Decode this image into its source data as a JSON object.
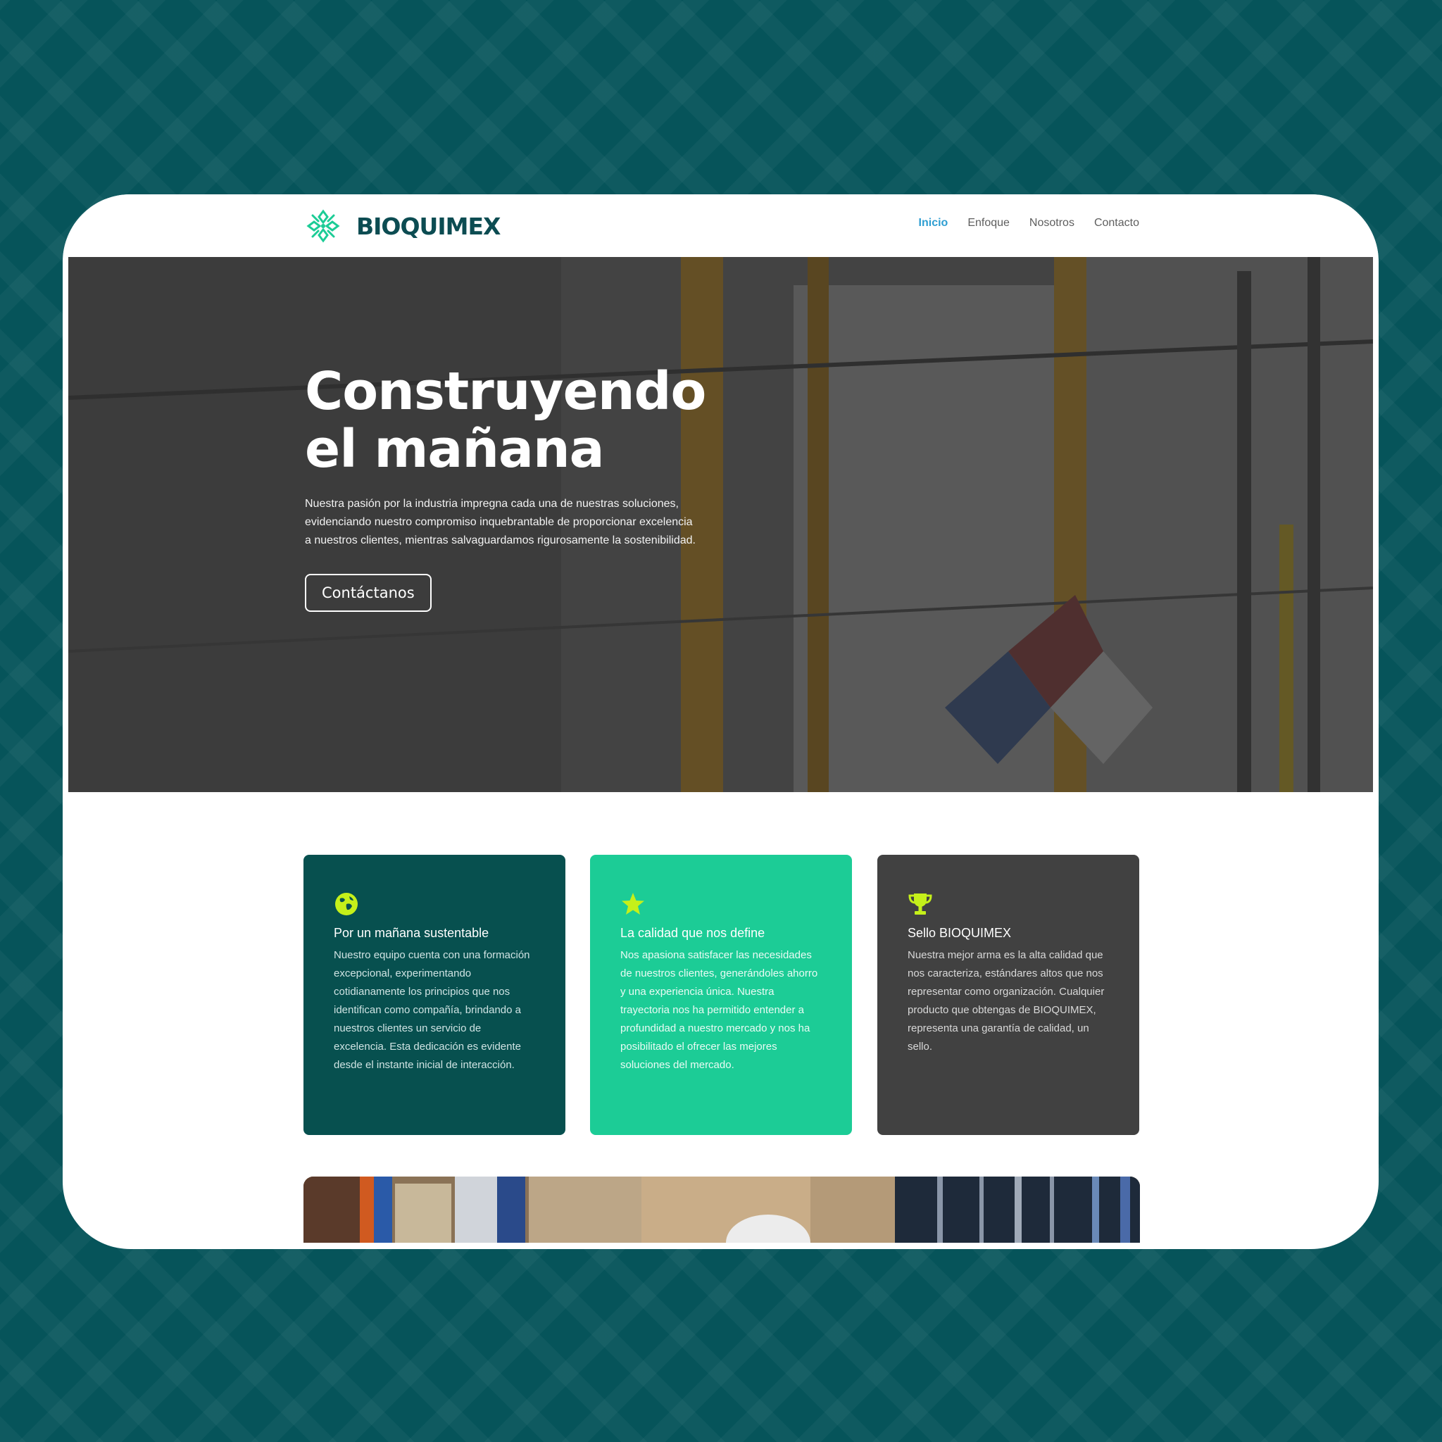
{
  "brand": {
    "name": "BIOQUIMEX",
    "logo_icon": "bioquimex-logo-icon",
    "primary_color": "#0c4c52",
    "accent_color": "#1ccc96",
    "nav_active_color": "#2e9ed2"
  },
  "nav": {
    "items": [
      {
        "label": "Inicio",
        "active": true
      },
      {
        "label": "Enfoque",
        "active": false
      },
      {
        "label": "Nosotros",
        "active": false
      },
      {
        "label": "Contacto",
        "active": false
      }
    ]
  },
  "hero": {
    "title_line1": "Construyendo",
    "title_line2": "el mañana",
    "text": "Nuestra pasión por la industria impregna cada una de nuestras soluciones, evidenciando nuestro compromiso inquebrantable de proporcionar excelencia a nuestros clientes, mientras salvaguardamos rigurosamente la sostenibilidad.",
    "button_label": "Contáctanos"
  },
  "features": [
    {
      "icon": "globe-icon",
      "title": "Por un mañana sustentable",
      "text": "Nuestro equipo cuenta con una formación excepcional, experimentando cotidianamente los principios que nos identifican como compañía, brindando a nuestros clientes un servicio de excelencia. Esta dedicación es evidente desde el instante inicial de interacción.",
      "color": "#07504f"
    },
    {
      "icon": "star-icon",
      "title": "La calidad que nos define",
      "text": "Nos apasiona satisfacer las necesidades de nuestros clientes, generándoles ahorro y una experiencia única. Nuestra trayectoria nos ha permitido entender a profundidad a nuestro mercado y nos ha posibilitado el ofrecer las mejores soluciones del mercado.",
      "color": "#1ccc96"
    },
    {
      "icon": "trophy-icon",
      "title": "Sello BIOQUIMEX",
      "text": "Nuestra mejor arma es la alta calidad que nos caracteriza, estándares altos que nos representar como organización. Cualquier producto que obtengas de BIOQUIMEX, representa una garantía de calidad, un sello.",
      "color": "#414141"
    }
  ],
  "icon_color": "#c5f01a"
}
